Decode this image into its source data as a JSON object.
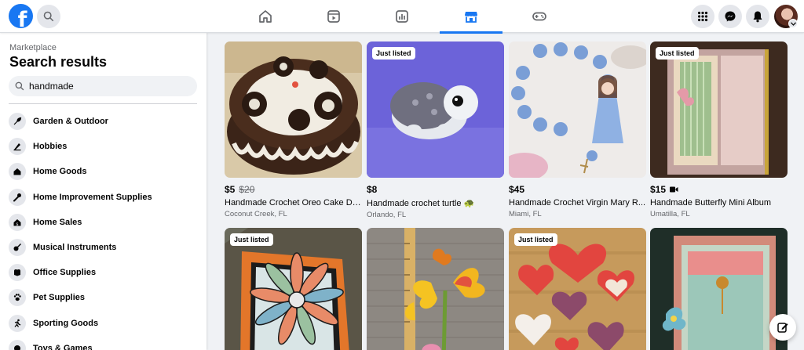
{
  "header": {
    "logo_letter": "f",
    "nav_icons": [
      "home-icon",
      "watch-icon",
      "feeds-icon",
      "marketplace-icon",
      "gaming-icon"
    ],
    "active_tab": "marketplace",
    "right_icons": [
      "menu-grid-icon",
      "messenger-icon",
      "notifications-icon"
    ],
    "accent": "#1877f2"
  },
  "sidebar": {
    "breadcrumb": "Marketplace",
    "title": "Search results",
    "search_value": "handmade",
    "categories": [
      {
        "label": "Garden & Outdoor",
        "icon": "garden-icon"
      },
      {
        "label": "Hobbies",
        "icon": "hobbies-icon"
      },
      {
        "label": "Home Goods",
        "icon": "home-goods-icon"
      },
      {
        "label": "Home Improvement Supplies",
        "icon": "tools-icon"
      },
      {
        "label": "Home Sales",
        "icon": "home-sales-icon"
      },
      {
        "label": "Musical Instruments",
        "icon": "guitar-icon"
      },
      {
        "label": "Office Supplies",
        "icon": "office-icon"
      },
      {
        "label": "Pet Supplies",
        "icon": "paw-icon"
      },
      {
        "label": "Sporting Goods",
        "icon": "sports-icon"
      },
      {
        "label": "Toys & Games",
        "icon": "toys-icon"
      }
    ]
  },
  "listings": [
    {
      "badge": "",
      "price": "$5",
      "old_price": "$20",
      "title": "Handmade Crochet Oreo Cake De...",
      "location": "Coconut Creek, FL",
      "video": false
    },
    {
      "badge": "Just listed",
      "price": "$8",
      "old_price": "",
      "title": "Handmade crochet turtle 🐢",
      "location": "Orlando, FL",
      "video": false
    },
    {
      "badge": "",
      "price": "$45",
      "old_price": "",
      "title": "Handmade Crochet Virgin Mary R...",
      "location": "Miami, FL",
      "video": false
    },
    {
      "badge": "Just listed",
      "price": "$15",
      "old_price": "",
      "title": "Handmade Butterfly Mini Album",
      "location": "Umatilla, FL",
      "video": true
    },
    {
      "badge": "Just listed",
      "price": "",
      "old_price": "",
      "title": "",
      "location": "",
      "video": false
    },
    {
      "badge": "",
      "price": "",
      "old_price": "",
      "title": "",
      "location": "",
      "video": false
    },
    {
      "badge": "Just listed",
      "price": "",
      "old_price": "",
      "title": "",
      "location": "",
      "video": false
    },
    {
      "badge": "",
      "price": "",
      "old_price": "",
      "title": "",
      "location": "",
      "video": false
    }
  ]
}
